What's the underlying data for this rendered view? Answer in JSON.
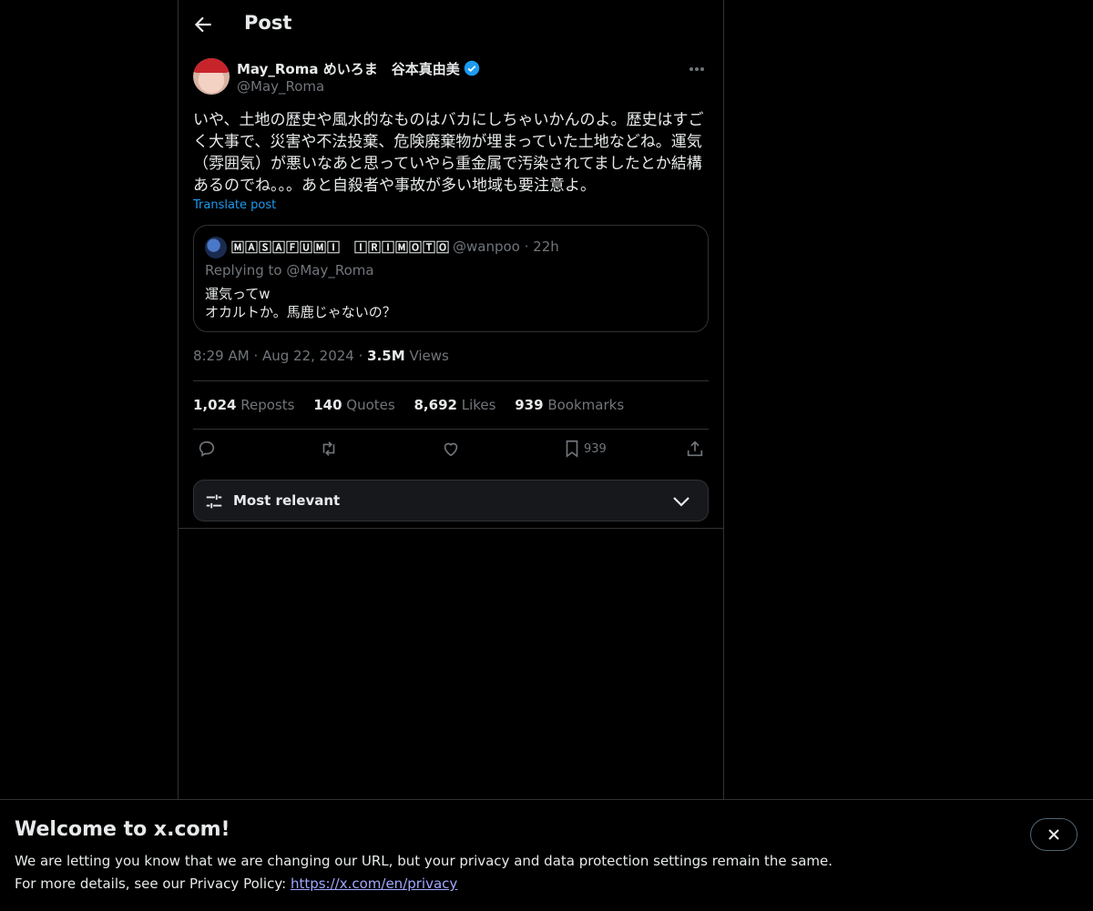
{
  "colors": {
    "background": "#000000",
    "text": "#e7e9ea",
    "muted": "#71767b",
    "accent": "#1d9bf0",
    "border": "#2f3336"
  },
  "header": {
    "title": "Post"
  },
  "post": {
    "author_name": "May_Roma めいろま　谷本真由美",
    "handle": "@May_Roma",
    "verified": true,
    "text": "いや、土地の歴史や風水的なものはバカにしちゃいかんのよ。歴史はすご\nく大事で、災害や不法投棄、危険廃棄物が埋まっていた土地などね。運気\n（雰囲気）が悪いなあと思っていやら重金属で汚染されてましたとか結構\nあるのでね。。。あと自殺者や事故が多い地域も要注意よ。",
    "translate_label": "Translate post",
    "time": "8:29 AM",
    "date": "Aug 22, 2024",
    "views_count": "3.5M",
    "views_label": "Views"
  },
  "quote": {
    "author_name": "🄼🄰🅂🄰🄵🅄🄼🄸　🄸🅁🄸🄼🄾🅃🄾",
    "handle": "@wanpoo",
    "time": "22h",
    "replying_to": "Replying to @May_Roma",
    "text": "運気ってw\nオカルトか。馬鹿じゃないの？"
  },
  "stats": {
    "reposts_count": "1,024",
    "reposts_label": "Reposts",
    "quotes_count": "140",
    "quotes_label": "Quotes",
    "likes_count": "8,692",
    "likes_label": "Likes",
    "bookmarks_count": "939",
    "bookmarks_label": "Bookmarks"
  },
  "actions": {
    "reply_icon": "reply-icon",
    "repost_icon": "repost-icon",
    "like_icon": "heart-icon",
    "bookmark_icon": "bookmark-icon",
    "bookmark_count": "939",
    "share_icon": "share-icon"
  },
  "sort": {
    "label": "Most relevant"
  },
  "banner": {
    "title": "Welcome to x.com!",
    "line1": "We are letting you know that we are changing our URL, but your privacy and data protection settings remain the same.",
    "line2_prefix": "For more details, see our Privacy Policy: ",
    "link": "https://x.com/en/privacy"
  }
}
